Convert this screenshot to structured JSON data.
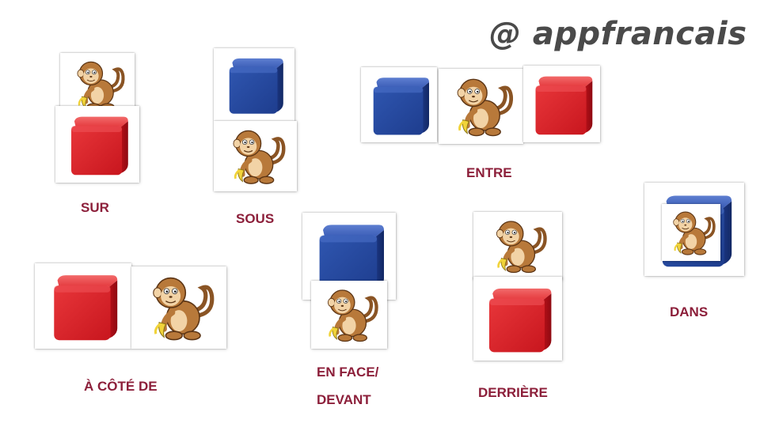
{
  "watermark": {
    "text": "@ appfrancais"
  },
  "labels": {
    "sur": "SUR",
    "sous": "SOUS",
    "entre": "ENTRE",
    "dans": "DANS",
    "a_cote_de": "À CÔTÉ DE",
    "en_face_line1": "EN FACE/",
    "en_face_line2": "DEVANT",
    "derriere": "DERRIÈRE"
  },
  "colors": {
    "label": "#8c1f3a",
    "red_cube": "#e0262e",
    "blue_cube": "#2a4da6",
    "monkey_fur": "#b8793a",
    "monkey_face": "#f2d3a6",
    "banana": "#f1d33a"
  },
  "icons": {
    "monkey": "monkey-icon",
    "red_cube": "red-cube-icon",
    "blue_cube": "blue-cube-icon"
  }
}
